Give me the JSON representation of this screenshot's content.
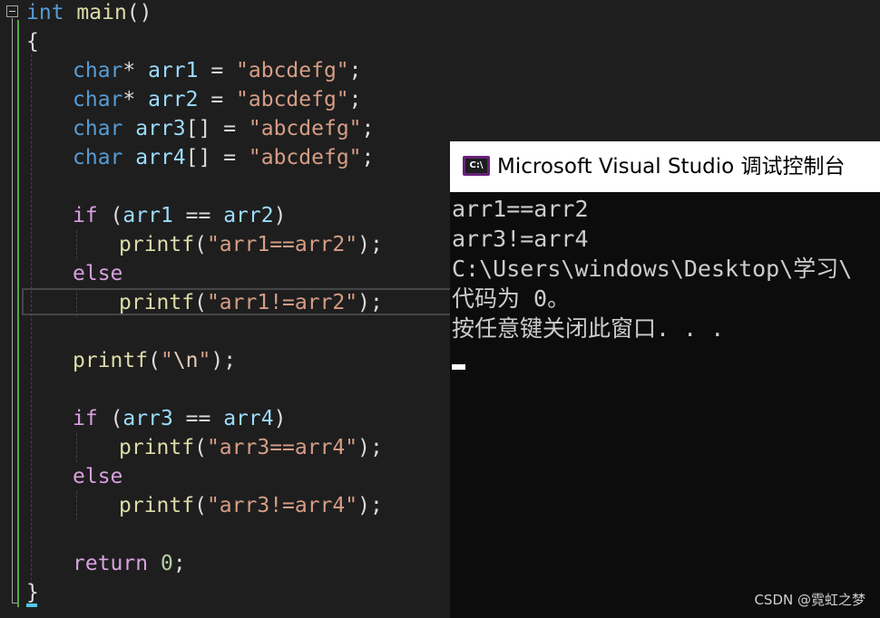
{
  "editor": {
    "line_main": {
      "kw": "int",
      "fn": "main",
      "rest": "()"
    },
    "open_brace": "{",
    "decl1": {
      "type": "char",
      "rest": "* ",
      "var": "arr1",
      "eq": " = ",
      "str": "\"abcdefg\"",
      "end": ";"
    },
    "decl2": {
      "type": "char",
      "rest": "* ",
      "var": "arr2",
      "eq": " = ",
      "str": "\"abcdefg\"",
      "end": ";"
    },
    "decl3": {
      "type": "char",
      "rest": " ",
      "var": "arr3",
      "br": "[]",
      "eq": " = ",
      "str": "\"abcdefg\"",
      "end": ";"
    },
    "decl4": {
      "type": "char",
      "rest": " ",
      "var": "arr4",
      "br": "[]",
      "eq": " = ",
      "str": "\"abcdefg\"",
      "end": ";"
    },
    "if1": {
      "kw": "if",
      "open": " (",
      "a": "arr1",
      "op": " == ",
      "b": "arr2",
      "close": ")"
    },
    "printf1": {
      "fn": "printf",
      "open": "(",
      "str": "\"arr1==arr2\"",
      "close": ");"
    },
    "else1": "else",
    "printf2": {
      "fn": "printf",
      "open": "(",
      "str": "\"arr1!=arr2\"",
      "close": ");"
    },
    "printf_nl": {
      "fn": "printf",
      "open": "(",
      "q1": "\"",
      "esc": "\\n",
      "q2": "\"",
      "close": ");"
    },
    "if2": {
      "kw": "if",
      "open": " (",
      "a": "arr3",
      "op": " == ",
      "b": "arr4",
      "close": ")"
    },
    "printf3": {
      "fn": "printf",
      "open": "(",
      "str": "\"arr3==arr4\"",
      "close": ");"
    },
    "else2": "else",
    "printf4": {
      "fn": "printf",
      "open": "(",
      "str": "\"arr3!=arr4\"",
      "close": ");"
    },
    "ret": {
      "kw": "return",
      "sp": " ",
      "num": "0",
      "end": ";"
    },
    "close_brace": "}"
  },
  "console": {
    "title": "Microsoft Visual Studio 调试控制台",
    "icon_label": "C:\\",
    "lines": [
      "arr1==arr2",
      "arr3!=arr4",
      "C:\\Users\\windows\\Desktop\\学习\\",
      "代码为 0。",
      "按任意键关闭此窗口. . ."
    ]
  },
  "watermark": "CSDN @霓虹之梦",
  "colors": {
    "keyword": "#569cd6",
    "control_keyword": "#d8a0df",
    "function": "#dcdcaa",
    "variable": "#9cdcfe",
    "string": "#d69d85",
    "number": "#b5cea8",
    "editor_bg": "#1e1e1e",
    "console_bg": "#0c0c0c",
    "vs_purple": "#68217a"
  }
}
